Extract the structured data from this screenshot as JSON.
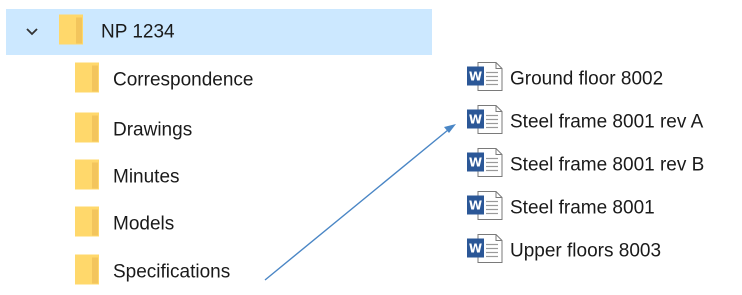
{
  "tree": {
    "root": {
      "label": "NP 1234",
      "icon": "folder-icon",
      "expanded": true,
      "selected": true,
      "expander_icon": "chevron-down-icon"
    },
    "children": [
      {
        "label": "Correspondence",
        "icon": "folder-icon"
      },
      {
        "label": "Drawings",
        "icon": "folder-icon"
      },
      {
        "label": "Minutes",
        "icon": "folder-icon"
      },
      {
        "label": "Models",
        "icon": "folder-icon"
      },
      {
        "label": "Specifications",
        "icon": "folder-icon"
      }
    ]
  },
  "files": [
    {
      "label": "Ground floor 8002",
      "icon": "word-document-icon"
    },
    {
      "label": "Steel frame 8001 rev A",
      "icon": "word-document-icon"
    },
    {
      "label": "Steel frame 8001 rev B",
      "icon": "word-document-icon"
    },
    {
      "label": "Steel frame 8001",
      "icon": "word-document-icon"
    },
    {
      "label": "Upper floors 8003",
      "icon": "word-document-icon"
    }
  ],
  "colors": {
    "selection_bg": "#cce8ff",
    "folder_fill": "#ffd86b",
    "folder_shade": "#e8b84a",
    "word_blue": "#2b5797",
    "arrow": "#4a86c5"
  }
}
